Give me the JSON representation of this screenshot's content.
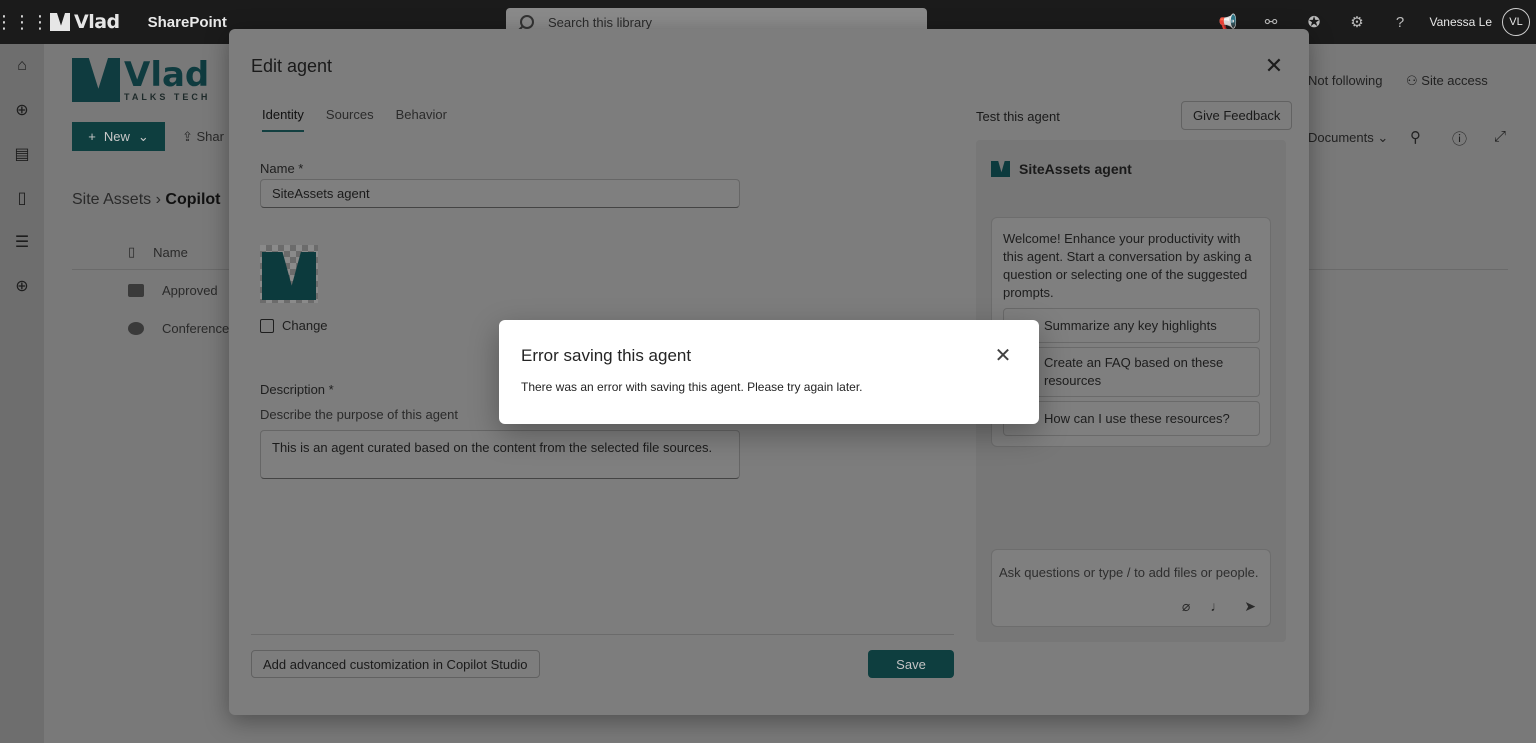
{
  "suite": {
    "logo_text": "Vlad",
    "app_name": "SharePoint",
    "search_placeholder": "Search this library",
    "user_name": "Vanessa Le",
    "user_initials": "VL"
  },
  "background": {
    "logo_text": "Vlad",
    "logo_subtext": "TALKS TECH",
    "new_button": "New",
    "share_button": "Shar",
    "breadcrumb_root": "Site Assets",
    "breadcrumb_current": "Copilot",
    "not_following": "Not following",
    "site_access": "Site access",
    "view_name": "Documents",
    "col_name": "Name",
    "rows": [
      "Approved",
      "Conference"
    ]
  },
  "panel": {
    "title": "Edit agent",
    "tabs": [
      "Identity",
      "Sources",
      "Behavior"
    ],
    "name_label": "Name *",
    "name_value": "SiteAssets agent",
    "change_label": "Change",
    "description_label": "Description *",
    "description_hint": "Describe the purpose of this agent",
    "description_value": "This is an agent curated based on the content from the selected file sources.",
    "advanced_button": "Add advanced customization in Copilot Studio",
    "save_button": "Save"
  },
  "test": {
    "title": "Test this agent",
    "feedback_button": "Give Feedback",
    "agent_name": "SiteAssets agent",
    "welcome": "Welcome! Enhance your productivity with this agent. Start a conversation by asking a question or selecting one of the suggested prompts.",
    "prompts": [
      "Summarize any key highlights",
      "Create an FAQ based on these resources",
      "How can I use these resources?"
    ],
    "input_placeholder": "Ask questions or type / to add files or people."
  },
  "dialog": {
    "title": "Error saving this agent",
    "message": "There was an error with saving this agent. Please try again later."
  },
  "colors": {
    "accent": "#0e3e3f",
    "suitebar": "#1b1b1b",
    "dialog_bg": "#ffffff"
  }
}
